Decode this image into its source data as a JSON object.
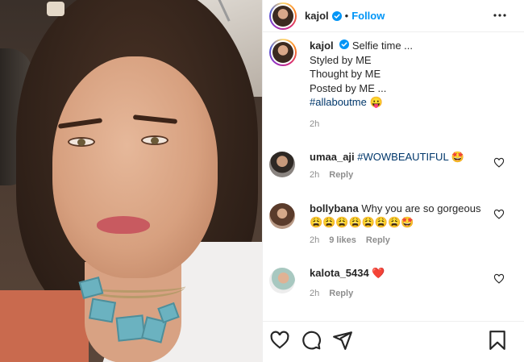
{
  "header": {
    "username": "kajol",
    "separator": "•",
    "follow_label": "Follow"
  },
  "caption": {
    "username": "kajol",
    "line1": "Selfie time ...",
    "line2": "Styled by ME",
    "line3": "Thought by ME",
    "line4": "Posted by ME ...",
    "hashtag": "#allaboutme",
    "emoji": "😛",
    "time": "2h"
  },
  "comments": [
    {
      "username": "umaa_aji",
      "text": "#WOWBEAUTIFUL",
      "emoji": "🤩",
      "time": "2h",
      "reply": "Reply"
    },
    {
      "username": "bollybana",
      "text": "Why you are so gorgeous",
      "emoji": "😩😩😩😩😩😩😩🤩",
      "time": "2h",
      "likes": "9 likes",
      "reply": "Reply"
    },
    {
      "username": "kalota_5434",
      "emoji": "❤️",
      "time": "2h",
      "reply": "Reply"
    }
  ],
  "colors": {
    "accent": "#0095f6",
    "hashtag": "#00376b",
    "muted": "#8e8e8e",
    "text": "#262626"
  },
  "icons": [
    "verified-badge-icon",
    "more-options-icon",
    "heart-icon",
    "comment-icon",
    "share-icon",
    "bookmark-icon"
  ]
}
